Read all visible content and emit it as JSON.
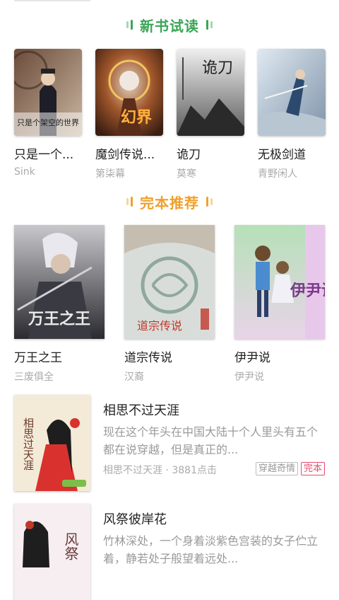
{
  "theme": {
    "green": "#3aa655",
    "orange": "#f0a02a"
  },
  "sections": {
    "new": {
      "title": "新书试读"
    },
    "complete": {
      "title": "完本推荐"
    }
  },
  "new_books": [
    {
      "title": "只是一个...",
      "author": "Sink"
    },
    {
      "title": "魔剑传说...",
      "author": "第柒幕"
    },
    {
      "title": "诡刀",
      "author": "莫寒"
    },
    {
      "title": "无极剑道",
      "author": "青野闲人"
    }
  ],
  "complete_books": [
    {
      "title": "万王之王",
      "author": "三废俱全"
    },
    {
      "title": "道宗传说",
      "author": "汉裔"
    },
    {
      "title": "伊尹说",
      "author": "伊尹说"
    }
  ],
  "list": [
    {
      "name": "相思不过天涯",
      "desc": "现在这个年头在中国大陆十个人里头有五个都在说穿越，但是真正的...",
      "meta": "相思不过天涯 · 3881点击",
      "tags": [
        "穿越奇情",
        "完本"
      ]
    },
    {
      "name": "风祭彼岸花",
      "desc": "竹林深处，一个身着淡紫色宫装的女子伫立着，静若处子般望着远处...",
      "meta": "",
      "tags": []
    }
  ],
  "cover_texts": {
    "b1": "只是个架空的世界",
    "b2": "幻界",
    "b3": "诡刀",
    "c1": "万王之王",
    "c2": "道宗传说",
    "c3": "伊尹说",
    "l1": "相思过天涯",
    "l2": "风祭"
  }
}
